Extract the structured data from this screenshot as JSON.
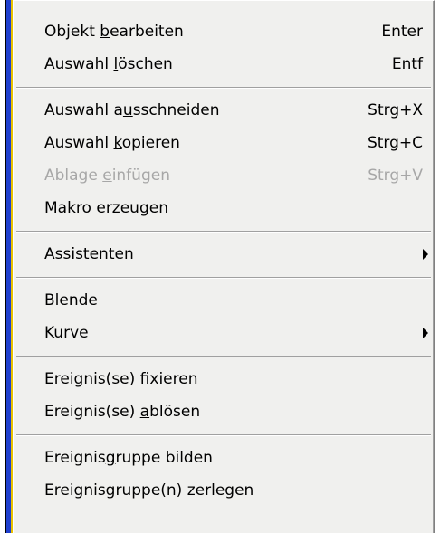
{
  "menu": {
    "items": [
      {
        "type": "item",
        "pre": "Objekt ",
        "u": "b",
        "post": "earbeiten",
        "shortcut": "Enter",
        "enabled": true,
        "submenu": false
      },
      {
        "type": "item",
        "pre": "Auswahl ",
        "u": "l",
        "post": "öschen",
        "shortcut": "Entf",
        "enabled": true,
        "submenu": false
      },
      {
        "type": "separator"
      },
      {
        "type": "item",
        "pre": "Auswahl a",
        "u": "u",
        "post": "sschneiden",
        "shortcut": "Strg+X",
        "enabled": true,
        "submenu": false
      },
      {
        "type": "item",
        "pre": "Auswahl ",
        "u": "k",
        "post": "opieren",
        "shortcut": "Strg+C",
        "enabled": true,
        "submenu": false
      },
      {
        "type": "item",
        "pre": "Ablage ",
        "u": "e",
        "post": "infügen",
        "shortcut": "Strg+V",
        "enabled": false,
        "submenu": false
      },
      {
        "type": "item",
        "pre": "",
        "u": "M",
        "post": "akro erzeugen",
        "shortcut": "",
        "enabled": true,
        "submenu": false
      },
      {
        "type": "separator"
      },
      {
        "type": "item",
        "pre": "Assistenten",
        "u": "",
        "post": "",
        "shortcut": "",
        "enabled": true,
        "submenu": true
      },
      {
        "type": "separator"
      },
      {
        "type": "item",
        "pre": "Blende",
        "u": "",
        "post": "",
        "shortcut": "",
        "enabled": true,
        "submenu": false
      },
      {
        "type": "item",
        "pre": "Kurve",
        "u": "",
        "post": "",
        "shortcut": "",
        "enabled": true,
        "submenu": true
      },
      {
        "type": "separator"
      },
      {
        "type": "item",
        "pre": "Ereignis(se) ",
        "u": "f",
        "post": "ixieren",
        "shortcut": "",
        "enabled": true,
        "submenu": false
      },
      {
        "type": "item",
        "pre": "Ereignis(se) ",
        "u": "a",
        "post": "blösen",
        "shortcut": "",
        "enabled": true,
        "submenu": false
      },
      {
        "type": "separator"
      },
      {
        "type": "item",
        "pre": "Ereignis",
        "u": "g",
        "post": "ruppe bilden",
        "shortcut": "",
        "enabled": true,
        "submenu": false
      },
      {
        "type": "item",
        "pre": "Ereignisgruppe(n) zerlegen",
        "u": "",
        "post": "",
        "shortcut": "",
        "enabled": true,
        "submenu": false
      }
    ]
  },
  "colors": {
    "menu_background": "#f0f0ee",
    "disabled_text": "#a7a7a7",
    "window_border_blue": "#1f3fcf",
    "window_border_yellow": "#e8c200"
  }
}
